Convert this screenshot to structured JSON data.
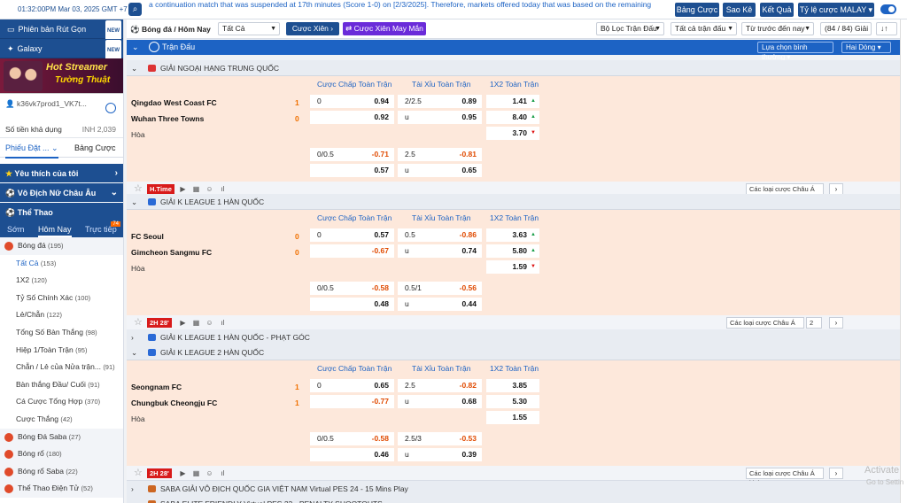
{
  "topbar": {
    "time": "01:32:00PM Mar 03, 2025 GMT +7",
    "ticker": "a continuation match that was suspended at 17th minutes (Score 1-0) on [2/3/2025]. Therefore, markets offered today that was based on the remaining",
    "buttons": [
      "Bảng Cược",
      "Sao Kê",
      "Kết Quả",
      "Tỷ lệ cược MALAY"
    ]
  },
  "sidebar": {
    "top_buttons": [
      "Phiên bản Rút Gọn",
      "Galaxy"
    ],
    "new_badge": "NEW",
    "banner_line1": "Hot Streamer",
    "banner_line2": "Tường Thuật",
    "account": "k36vk7prod1_VK7t...",
    "balance_label": "Số tiền khả dụng",
    "balance_value": "INH 2,039",
    "tabs": [
      "Phiếu Đặt ...",
      "Bảng Cược"
    ],
    "sections": [
      "Yêu thích của tôi",
      "Vô Địch Nữ Châu Âu",
      "Thể Thao"
    ],
    "sport_tabs": [
      "Sớm",
      "Hôm Nay",
      "Trực tiếp"
    ],
    "live_count": "74",
    "items": [
      {
        "label": "Bóng đá",
        "count": "(195)",
        "sport": true
      },
      {
        "label": "Tất Cả",
        "count": "(153)",
        "active": true
      },
      {
        "label": "1X2",
        "count": "(120)"
      },
      {
        "label": "Tỷ Số Chính Xác",
        "count": "(100)"
      },
      {
        "label": "Lẻ/Chẵn",
        "count": "(122)"
      },
      {
        "label": "Tổng Số Bàn Thắng",
        "count": "(98)"
      },
      {
        "label": "Hiệp 1/Toàn Trận",
        "count": "(95)"
      },
      {
        "label": "Chẵn / Lẻ của Nửa trận...",
        "count": "(91)"
      },
      {
        "label": "Bàn thắng Đầu/ Cuối",
        "count": "(91)"
      },
      {
        "label": "Cá Cược Tổng Hợp",
        "count": "(370)"
      },
      {
        "label": "Cược Thắng",
        "count": "(42)"
      },
      {
        "label": "Bóng Đá Saba",
        "count": "(27)",
        "sport": true
      },
      {
        "label": "Bóng rổ",
        "count": "(180)",
        "sport": true
      },
      {
        "label": "Bóng rổ Saba",
        "count": "(22)",
        "sport": true
      },
      {
        "label": "Thể Thao Điện Tử",
        "count": "(52)",
        "sport": true
      }
    ]
  },
  "filterbar": {
    "title": "Bóng đá / Hôm Nay",
    "market": "Tất Cả",
    "parlay": "Cược Xiên",
    "lucky_parlay": "Cược Xiên May Mắn",
    "league_filter": "Bộ Lọc Trận Đấu",
    "all_matches": "Tất cả trận đấu",
    "sort": "Từ trước đến nay",
    "match_count": "(84 / 84) Giải"
  },
  "header": {
    "title": "Trận Đấu",
    "view_select": "Lựa chọn bình thường",
    "lines_select": "Hai Dòng"
  },
  "col_headers": [
    "Cược Chấp Toàn Trận",
    "Tài Xỉu Toàn Trận",
    "1X2 Toàn Trận"
  ],
  "draw_label": "Hòa",
  "under_label": "u",
  "asia_types": "Các loại cược Châu Á khác",
  "leagues": [
    {
      "name": "GIẢI NGOẠI HẠNG TRUNG QUỐC"
    },
    {
      "name": "GIẢI K LEAGUE 1 HÀN QUỐC"
    },
    {
      "name": "GIẢI K LEAGUE 1 HÀN QUỐC - PHẠT GÓC"
    },
    {
      "name": "GIẢI K LEAGUE 2 HÀN QUỐC"
    },
    {
      "name": "SABA GIẢI VÔ ĐỊCH QUỐC GIA VIỆT NAM Virtual PES 24 - 15 Mins Play"
    },
    {
      "name": "SABA ELITE FRIENDLY Virtual PES 23 - PENALTY SHOOTOUTS"
    }
  ],
  "matches": [
    {
      "home": "Qingdao West Coast FC",
      "away": "Wuhan Three Towns",
      "home_score": "1",
      "away_score": "0",
      "time_badge": "H.Time",
      "hdp": [
        [
          "0",
          "0.94"
        ],
        [
          "",
          "0.92"
        ]
      ],
      "ou": [
        [
          "2/2.5",
          "0.89"
        ],
        [
          "u",
          "0.95"
        ]
      ],
      "x12": [
        "1.41",
        "8.40",
        "3.70"
      ],
      "hdp2": [
        [
          "0/0.5",
          "-0.71"
        ],
        [
          "",
          "0.57"
        ]
      ],
      "ou2": [
        [
          "2.5",
          "-0.81"
        ],
        [
          "u",
          "0.65"
        ]
      ],
      "more_count": ""
    },
    {
      "home": "FC Seoul",
      "away": "Gimcheon Sangmu FC",
      "home_score": "0",
      "away_score": "0",
      "time_badge": "2H 28'",
      "hdp": [
        [
          "0",
          "0.57"
        ],
        [
          "",
          "-0.67"
        ]
      ],
      "ou": [
        [
          "0.5",
          "-0.86"
        ],
        [
          "u",
          "0.74"
        ]
      ],
      "x12": [
        "3.63",
        "5.80",
        "1.59"
      ],
      "hdp2": [
        [
          "0/0.5",
          "-0.58"
        ],
        [
          "",
          "0.48"
        ]
      ],
      "ou2": [
        [
          "0.5/1",
          "-0.56"
        ],
        [
          "u",
          "0.44"
        ]
      ],
      "more_count": "2"
    },
    {
      "home": "Seongnam FC",
      "away": "Chungbuk Cheongju FC",
      "home_score": "1",
      "away_score": "1",
      "time_badge": "2H 28'",
      "hdp": [
        [
          "0",
          "0.65"
        ],
        [
          "",
          "-0.77"
        ]
      ],
      "ou": [
        [
          "2.5",
          "-0.82"
        ],
        [
          "u",
          "0.68"
        ]
      ],
      "x12": [
        "3.85",
        "5.30",
        "1.55"
      ],
      "hdp2": [
        [
          "0/0.5",
          "-0.58"
        ],
        [
          "",
          "0.46"
        ]
      ],
      "ou2": [
        [
          "2.5/3",
          "-0.53"
        ],
        [
          "u",
          "0.39"
        ]
      ],
      "more_count": ""
    }
  ],
  "watermark": {
    "line1": "Activate",
    "line2": "Go to Settin"
  },
  "colors": {
    "primary": "#1d4f91",
    "accent": "#1d63c4",
    "match_bg": "#fde8db",
    "negative": "#e04a00",
    "score": "#f07000"
  }
}
